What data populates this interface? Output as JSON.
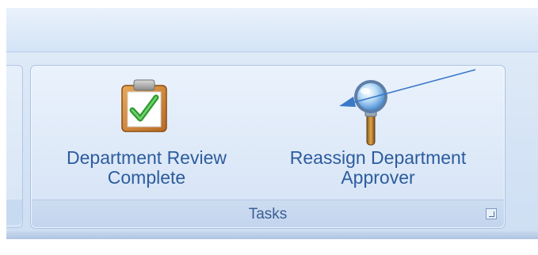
{
  "ribbon": {
    "group": {
      "caption": "Tasks",
      "buttons": [
        {
          "line1": "Department Review",
          "line2": "Complete",
          "icon": "clipboard-check-icon"
        },
        {
          "line1": "Reassign Department",
          "line2": "Approver",
          "icon": "magnifier-icon"
        }
      ],
      "dialog_launcher_icon": "dialog-launcher-icon"
    }
  },
  "annotation": {
    "type": "arrow",
    "color": "#3a78c8"
  },
  "colors": {
    "label_text": "#2c5c9e",
    "caption_text": "#3b5f94",
    "group_border": "#a9c2e2"
  }
}
